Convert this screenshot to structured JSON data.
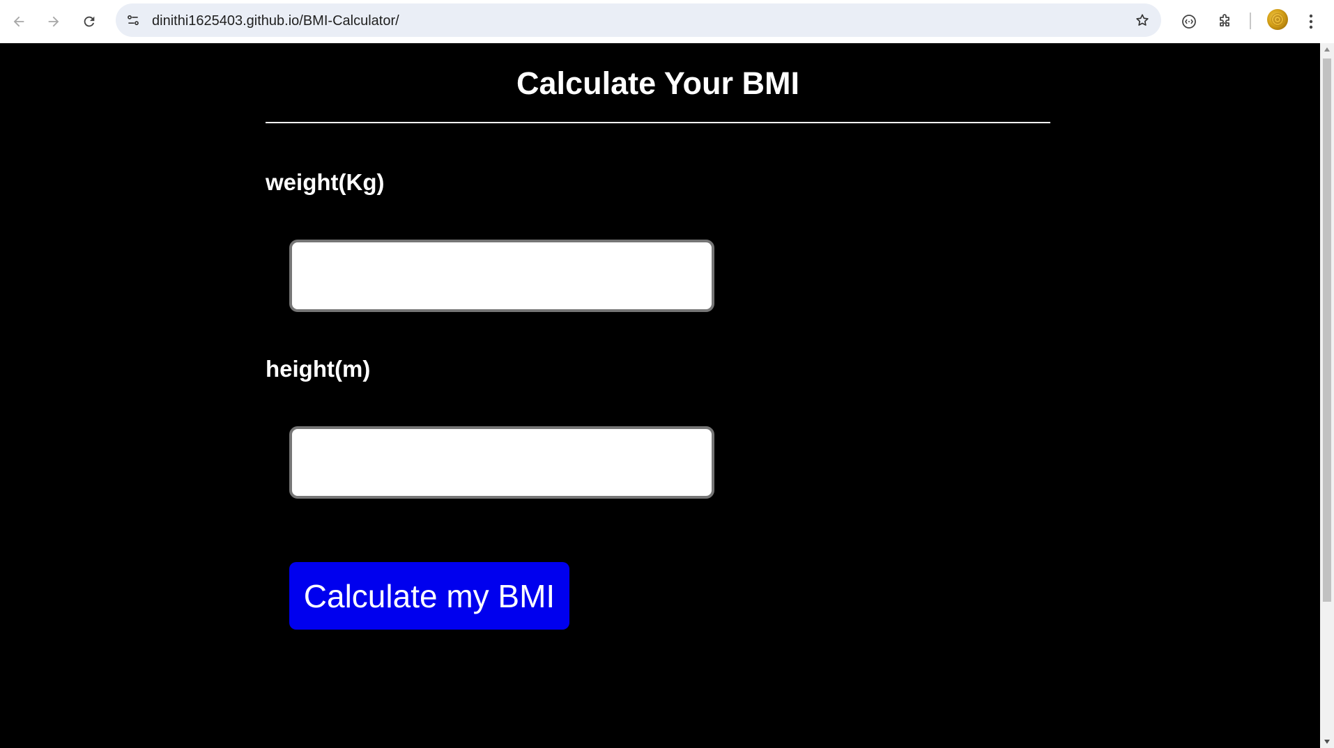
{
  "browser": {
    "url": "dinithi1625403.github.io/BMI-Calculator/",
    "icons": {
      "back": "back-arrow-icon",
      "forward": "forward-arrow-icon",
      "reload": "reload-icon",
      "site_info": "site-settings-icon",
      "bookmark": "star-icon",
      "media": "media-router-icon",
      "extensions": "puzzle-icon",
      "menu": "kebab-menu-icon"
    }
  },
  "page": {
    "title": "Calculate Your BMI",
    "weight_label": "weight(Kg)",
    "weight_value": "",
    "height_label": "height(m)",
    "height_value": "",
    "button_label": "Calculate my BMI"
  },
  "colors": {
    "background": "#000000",
    "text": "#ffffff",
    "button": "#0000ee"
  }
}
